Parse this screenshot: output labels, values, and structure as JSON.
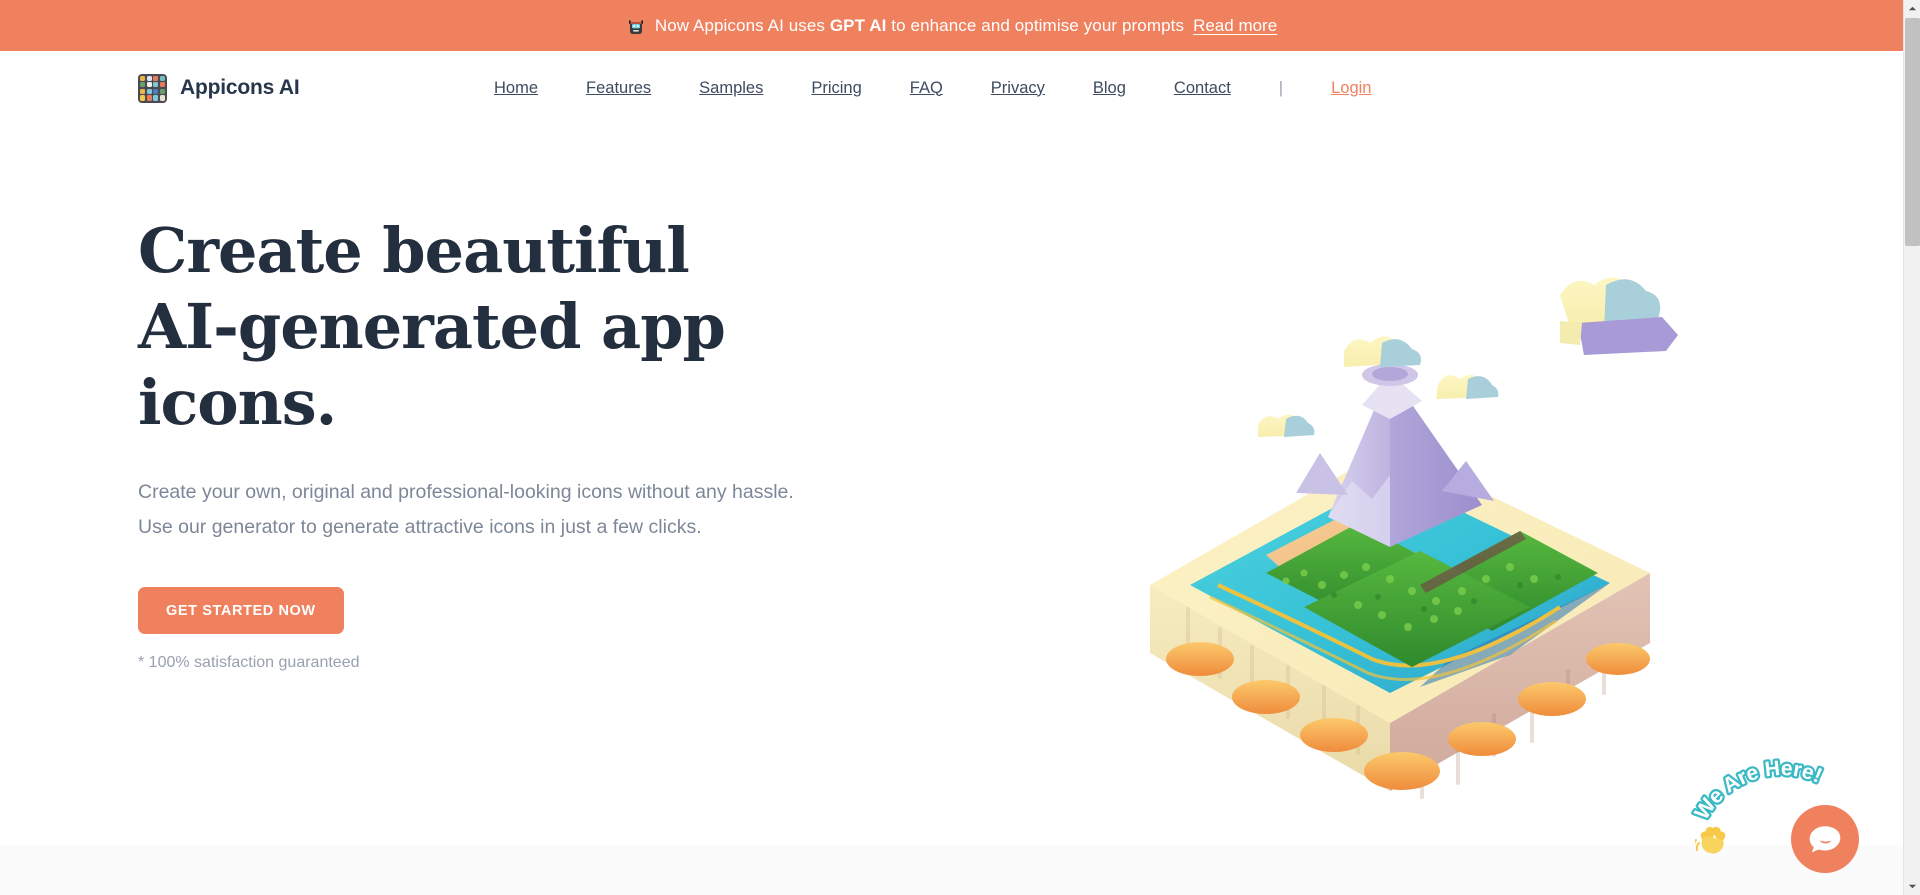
{
  "banner": {
    "icon": "robot-icon",
    "text_before": "Now Appicons AI uses ",
    "highlight": "GPT AI",
    "text_after": " to enhance and optimise your prompts",
    "link_label": "Read more",
    "background_color": "#F0815F"
  },
  "brand": {
    "name": "Appicons AI",
    "logo_icon": "grid-tiles-logo-icon",
    "logo_tiles": [
      "#e8b84b",
      "#d9e6f2",
      "#e87b5a",
      "#6fbfbf",
      "#6b9e6b",
      "#f2f2e8",
      "#7ec8d8",
      "#e87b5a",
      "#e8b84b",
      "#7ec8d8",
      "#4a7fbf",
      "#6b9e6b",
      "#f2c94c",
      "#e87b5a",
      "#7ec8d8",
      "#e8e3d5"
    ]
  },
  "nav": {
    "items": [
      {
        "label": "Home"
      },
      {
        "label": "Features"
      },
      {
        "label": "Samples"
      },
      {
        "label": "Pricing"
      },
      {
        "label": "FAQ"
      },
      {
        "label": "Privacy"
      },
      {
        "label": "Blog"
      },
      {
        "label": "Contact"
      }
    ],
    "separator": "|",
    "login_label": "Login",
    "login_color": "#F0815F"
  },
  "hero": {
    "title_line1": "Create beautiful",
    "title_line2": "AI-generated app",
    "title_line3": "icons.",
    "title_color": "#232f3e",
    "subtitle": "Create your own, original and professional-looking icons without any hassle. Use our generator to generate attractive icons in just a few clicks.",
    "cta_label": "GET STARTED NOW",
    "cta_color": "#F0815F",
    "note": "* 100% satisfaction guaranteed",
    "illustration_name": "isometric-island-volcano-illustration"
  },
  "chat": {
    "arc_text": "We Are Here!",
    "arc_color": "#3bb9c4",
    "hand_icon": "waving-hand-icon",
    "bubble_icon": "chat-bubble-icon",
    "button_color": "#F0815F"
  },
  "scrollbar": {
    "up_arrow": "scroll-up-arrow-icon",
    "down_arrow": "scroll-down-arrow-icon"
  }
}
